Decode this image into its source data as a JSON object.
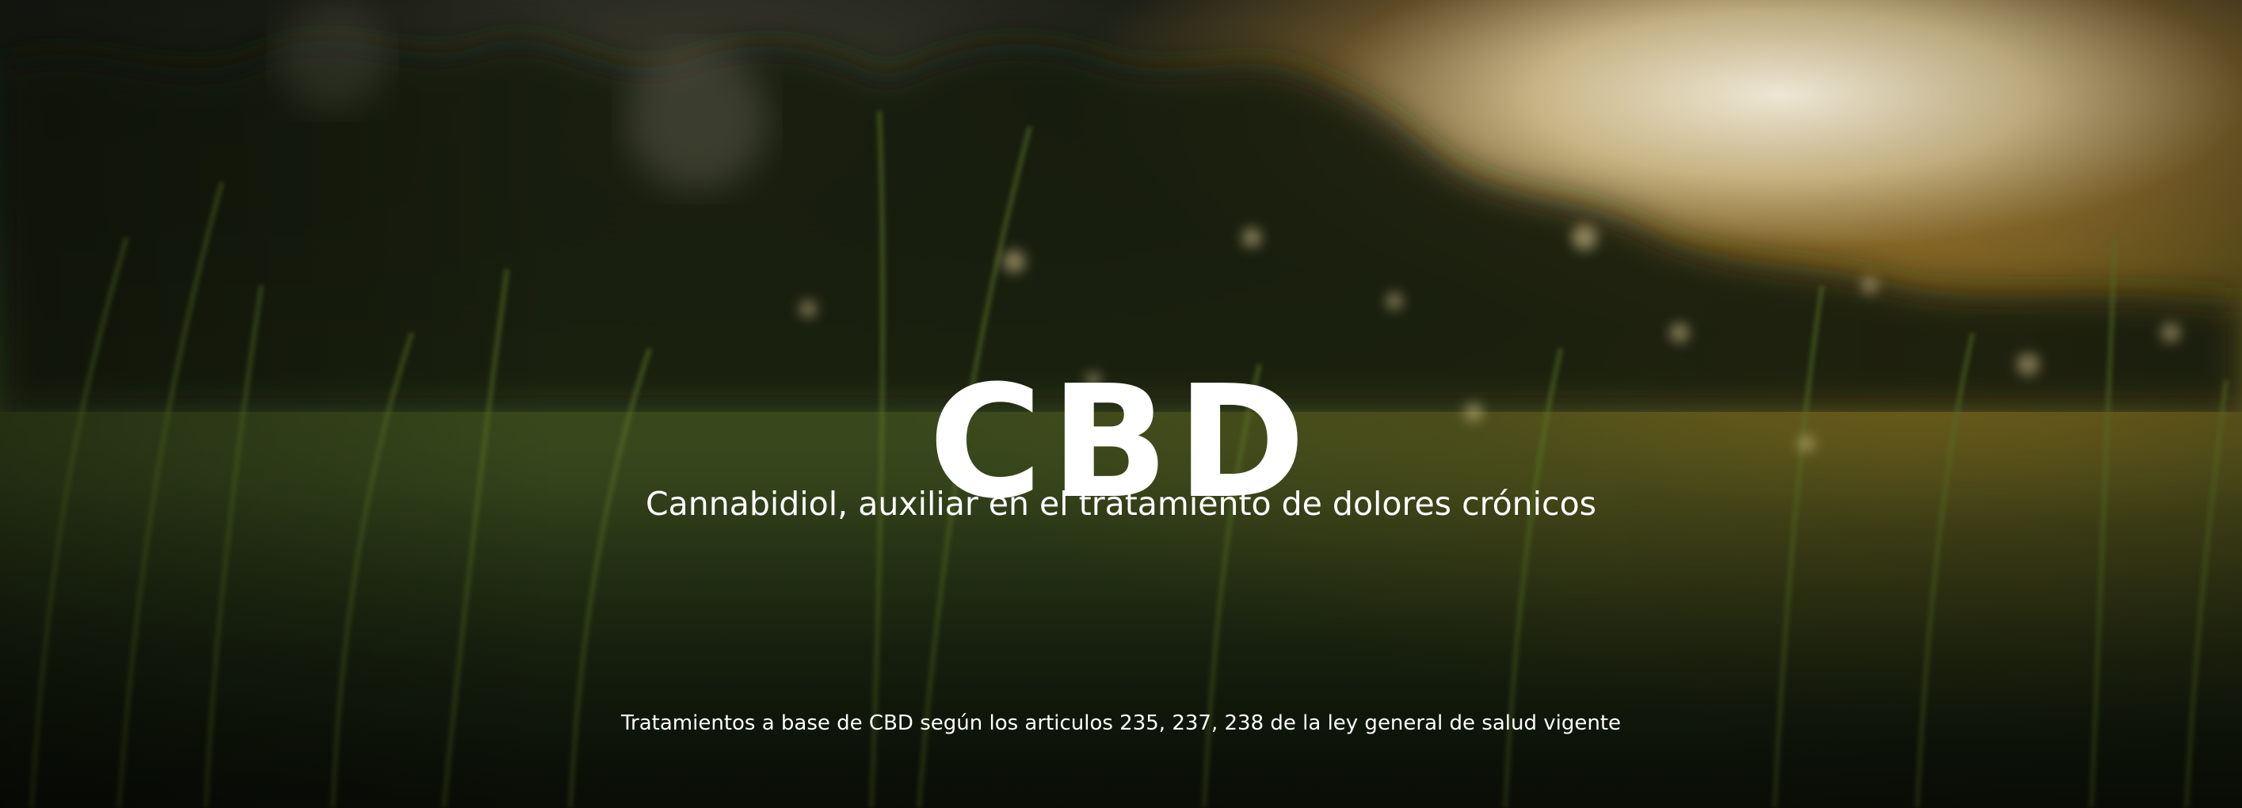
{
  "hero": {
    "title": "CBD",
    "subtitle": "Cannabidiol, auxiliar en el tratamiento de dolores crónicos",
    "note": "Tratamientos a base de CBD según los articulos 235, 237, 238 de la ley general de salud vigente"
  },
  "colors": {
    "text": "#ffffff",
    "sky_glow": "#fff8e6",
    "grass_dark": "#1e2a12",
    "grass_mid": "#3b4a1c"
  }
}
